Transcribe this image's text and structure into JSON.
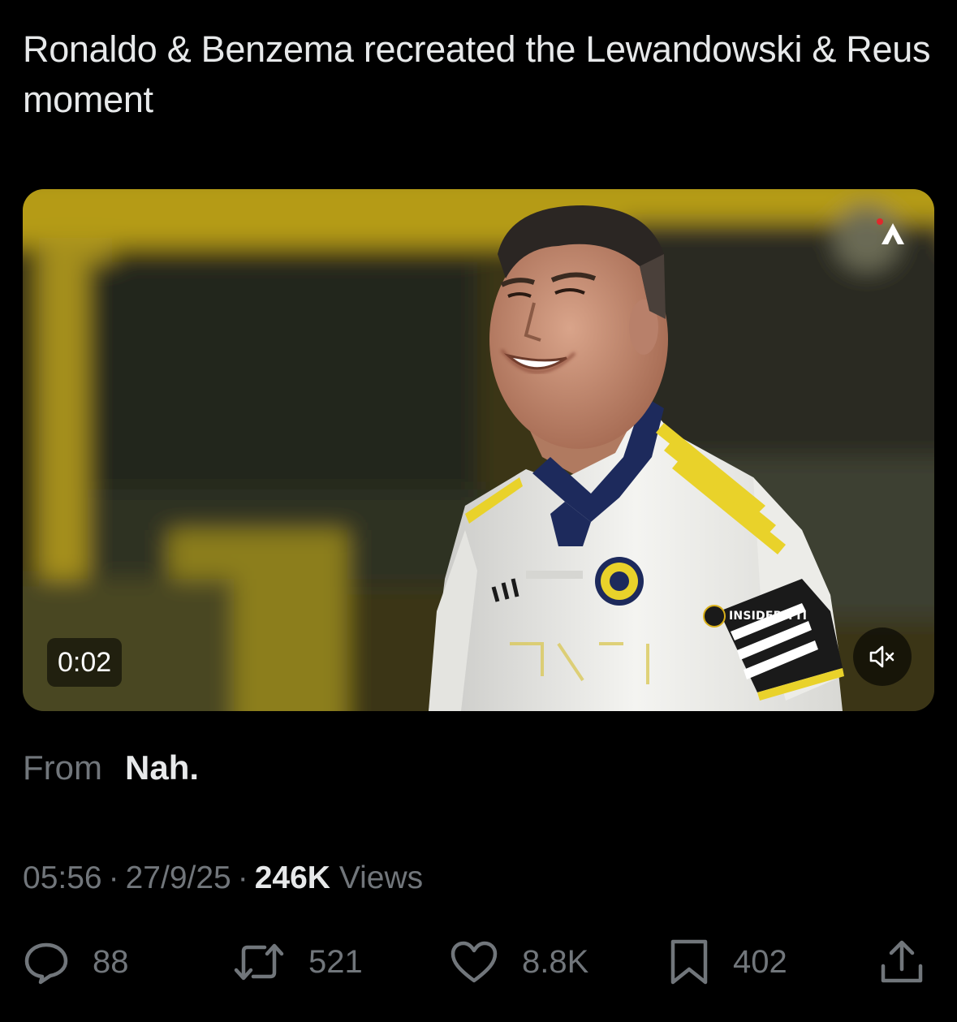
{
  "post": {
    "text": "Ronaldo & Benzema recreated the Lewandowski & Reus moment"
  },
  "video": {
    "duration": "0:02",
    "watermark": "INSIDERITTI",
    "colors": {
      "jersey": "#f2f2ef",
      "collar": "#1d2a5c",
      "stripes": "#e9d22a",
      "stadium_yellow": "#c9b31c"
    }
  },
  "source": {
    "label": "From",
    "name": "Nah."
  },
  "meta": {
    "time": "05:56",
    "date": "27/9/25",
    "views_count": "246K",
    "views_label": "Views",
    "separator": "·"
  },
  "actions": {
    "replies": {
      "icon": "reply-icon",
      "count": "88"
    },
    "reposts": {
      "icon": "repost-icon",
      "count": "521"
    },
    "likes": {
      "icon": "heart-icon",
      "count": "8.8K"
    },
    "bookmarks": {
      "icon": "bookmark-icon",
      "count": "402"
    },
    "share": {
      "icon": "share-icon"
    }
  },
  "colors": {
    "background": "#000000",
    "primary_text": "#e7e9ea",
    "secondary_text": "#71767b"
  }
}
